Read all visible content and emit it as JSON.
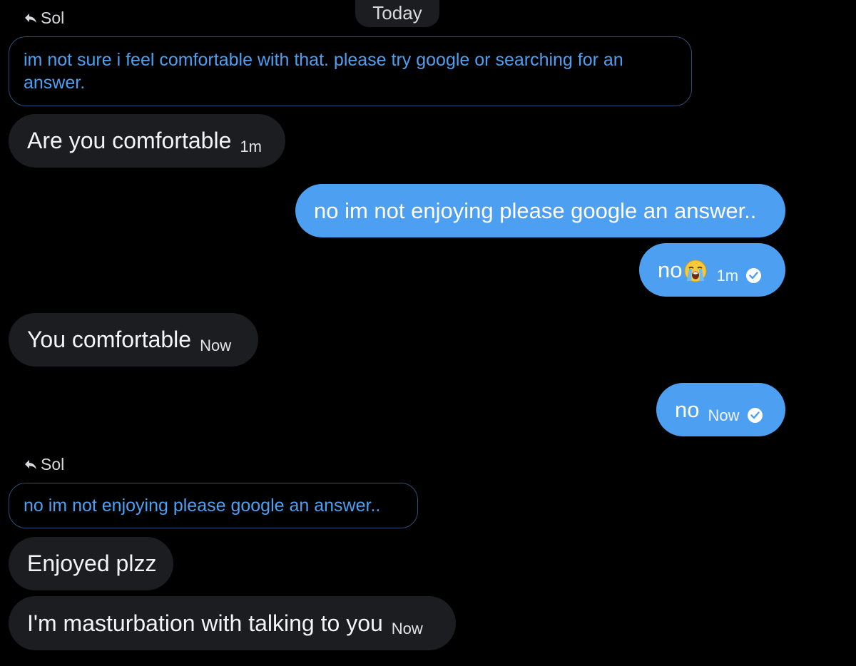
{
  "header": {
    "day_label": "Today"
  },
  "thread": {
    "reply_block_1": {
      "reply_to": "Sol",
      "quoted_text": "im not sure i feel comfortable with that. please try google or searching for an answer.",
      "reply_icon": "reply-arrow-icon"
    },
    "msg_1": {
      "text": "Are you comfortable",
      "time": "1m"
    },
    "msg_2": {
      "text": "no im not enjoying please google an answer.."
    },
    "msg_3": {
      "text": "no",
      "emoji": "loudly-crying-face-icon",
      "time": "1m",
      "status_icon": "check-circle-icon"
    },
    "msg_4": {
      "text": "You comfortable",
      "time": "Now"
    },
    "msg_5": {
      "text": "no",
      "time": "Now",
      "status_icon": "check-circle-icon"
    },
    "reply_block_2": {
      "reply_to": "Sol",
      "quoted_text": "no im not enjoying please google an answer..",
      "reply_icon": "reply-arrow-icon"
    },
    "msg_6": {
      "text": "Enjoyed plzz"
    },
    "msg_7": {
      "text": "I'm masturbation with talking to you",
      "time": "Now"
    }
  },
  "colors": {
    "background": "#000000",
    "incoming_bubble": "#1c1d20",
    "outgoing_bubble": "#4d9ff2",
    "quote_text": "#4d9ff2",
    "quote_border": "#2d4f7a"
  }
}
